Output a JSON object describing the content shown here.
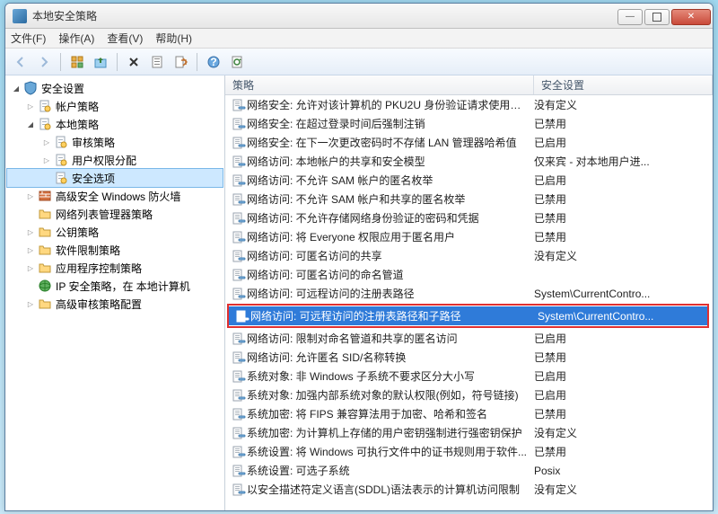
{
  "window": {
    "title": "本地安全策略"
  },
  "menu": {
    "file": "文件(F)",
    "action": "操作(A)",
    "view": "查看(V)",
    "help": "帮助(H)"
  },
  "tree": {
    "root": "安全设置",
    "items": [
      {
        "label": "帐户策略",
        "icon": "doc",
        "arrow": "closed",
        "indent": 1
      },
      {
        "label": "本地策略",
        "icon": "doc",
        "arrow": "open",
        "indent": 1
      },
      {
        "label": "审核策略",
        "icon": "doc",
        "arrow": "closed",
        "indent": 2
      },
      {
        "label": "用户权限分配",
        "icon": "doc",
        "arrow": "closed",
        "indent": 2
      },
      {
        "label": "安全选项",
        "icon": "doc",
        "arrow": "none",
        "indent": 2,
        "selected": true
      },
      {
        "label": "高级安全 Windows 防火墙",
        "icon": "wall",
        "arrow": "closed",
        "indent": 1
      },
      {
        "label": "网络列表管理器策略",
        "icon": "folder",
        "arrow": "none",
        "indent": 1
      },
      {
        "label": "公钥策略",
        "icon": "folder",
        "arrow": "closed",
        "indent": 1
      },
      {
        "label": "软件限制策略",
        "icon": "folder",
        "arrow": "closed",
        "indent": 1
      },
      {
        "label": "应用程序控制策略",
        "icon": "folder",
        "arrow": "closed",
        "indent": 1
      },
      {
        "label": "IP 安全策略，在 本地计算机",
        "icon": "ip",
        "arrow": "none",
        "indent": 1
      },
      {
        "label": "高级审核策略配置",
        "icon": "folder",
        "arrow": "closed",
        "indent": 1
      }
    ]
  },
  "columns": {
    "policy": "策略",
    "setting": "安全设置"
  },
  "rows": [
    {
      "policy": "网络安全: 允许对该计算机的 PKU2U 身份验证请求使用联...",
      "setting": "没有定义"
    },
    {
      "policy": "网络安全: 在超过登录时间后强制注销",
      "setting": "已禁用"
    },
    {
      "policy": "网络安全: 在下一次更改密码时不存储 LAN 管理器哈希值",
      "setting": "已启用"
    },
    {
      "policy": "网络访问: 本地帐户的共享和安全模型",
      "setting": "仅来宾 - 对本地用户进..."
    },
    {
      "policy": "网络访问: 不允许 SAM 帐户的匿名枚举",
      "setting": "已启用"
    },
    {
      "policy": "网络访问: 不允许 SAM 帐户和共享的匿名枚举",
      "setting": "已禁用"
    },
    {
      "policy": "网络访问: 不允许存储网络身份验证的密码和凭据",
      "setting": "已禁用"
    },
    {
      "policy": "网络访问: 将 Everyone 权限应用于匿名用户",
      "setting": "已禁用"
    },
    {
      "policy": "网络访问: 可匿名访问的共享",
      "setting": "没有定义"
    },
    {
      "policy": "网络访问: 可匿名访问的命名管道",
      "setting": ""
    },
    {
      "policy": "网络访问: 可远程访问的注册表路径",
      "setting": "System\\CurrentContro..."
    },
    {
      "policy": "网络访问: 可远程访问的注册表路径和子路径",
      "setting": "System\\CurrentContro...",
      "selected": true,
      "highlight": true
    },
    {
      "policy": "网络访问: 限制对命名管道和共享的匿名访问",
      "setting": "已启用"
    },
    {
      "policy": "网络访问: 允许匿名 SID/名称转换",
      "setting": "已禁用"
    },
    {
      "policy": "系统对象: 非 Windows 子系统不要求区分大小写",
      "setting": "已启用"
    },
    {
      "policy": "系统对象: 加强内部系统对象的默认权限(例如，符号链接)",
      "setting": "已启用"
    },
    {
      "policy": "系统加密: 将 FIPS 兼容算法用于加密、哈希和签名",
      "setting": "已禁用"
    },
    {
      "policy": "系统加密: 为计算机上存储的用户密钥强制进行强密钥保护",
      "setting": "没有定义"
    },
    {
      "policy": "系统设置: 将 Windows 可执行文件中的证书规则用于软件...",
      "setting": "已禁用"
    },
    {
      "policy": "系统设置: 可选子系统",
      "setting": "Posix"
    },
    {
      "policy": "以安全描述符定义语言(SDDL)语法表示的计算机访问限制",
      "setting": "没有定义"
    }
  ]
}
